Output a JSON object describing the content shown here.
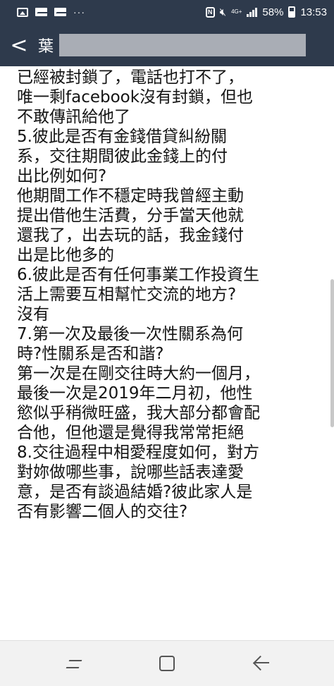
{
  "status_bar": {
    "dots": "···",
    "nfc": "N",
    "network": "4G+",
    "battery": "58%",
    "time": "13:53"
  },
  "header": {
    "back": "<",
    "title": "葉"
  },
  "message": {
    "lines": [
      "已經被封鎖了，電話也打不了，",
      "唯一剩facebook沒有封鎖，但也",
      "不敢傳訊給他了",
      "5.彼此是否有金錢借貸糾紛關",
      "系，交往期間彼此金錢上的付",
      "出比例如何?",
      "他期間工作不穩定時我曾經主動",
      "提出借他生活費，分手當天他就",
      "還我了，出去玩的話，我金錢付",
      "出是比他多的",
      "6.彼此是否有任何事業工作投資生",
      "活上需要互相幫忙交流的地方?",
      "沒有",
      "7.第一次及最後一次性關系為何",
      "時?性關系是否和諧?",
      "第一次是在剛交往時大約一個月，",
      "最後一次是2019年二月初，他性",
      "慾似乎稍微旺盛，我大部分都會配",
      "合他，但他還是覺得我常常拒絕",
      "8.交往過程中相愛程度如何，對方",
      "對妳做哪些事，說哪些話表達愛",
      "意，是否有談過結婚?彼此家人是",
      "否有影響二個人的交往?"
    ]
  },
  "colors": {
    "header_bg": "#2e3a4c",
    "text": "#141414",
    "nav_bg": "#f2f2f2"
  }
}
